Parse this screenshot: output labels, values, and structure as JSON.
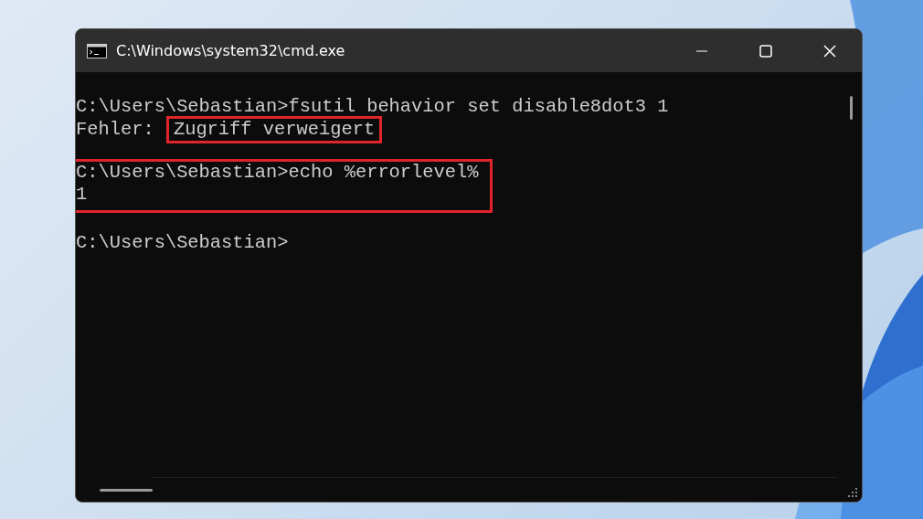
{
  "window": {
    "title": "C:\\Windows\\system32\\cmd.exe"
  },
  "console": {
    "blocks": [
      {
        "highlighted": false,
        "lines": [
          {
            "segments": [
              {
                "text": "C:\\Users\\Sebastian>fsutil behavior set disable8dot3 1",
                "highlighted": false
              }
            ]
          },
          {
            "segments": [
              {
                "text": "Fehler: ",
                "highlighted": false
              },
              {
                "text": "Zugriff verweigert",
                "highlighted": true
              }
            ]
          }
        ]
      },
      {
        "highlighted": true,
        "lines": [
          {
            "segments": [
              {
                "text": "C:\\Users\\Sebastian>echo %errorlevel%",
                "highlighted": false
              }
            ]
          },
          {
            "segments": [
              {
                "text": "1",
                "highlighted": false
              }
            ]
          }
        ]
      },
      {
        "highlighted": false,
        "lines": [
          {
            "segments": [
              {
                "text": "C:\\Users\\Sebastian>",
                "highlighted": false
              }
            ]
          }
        ]
      }
    ]
  }
}
